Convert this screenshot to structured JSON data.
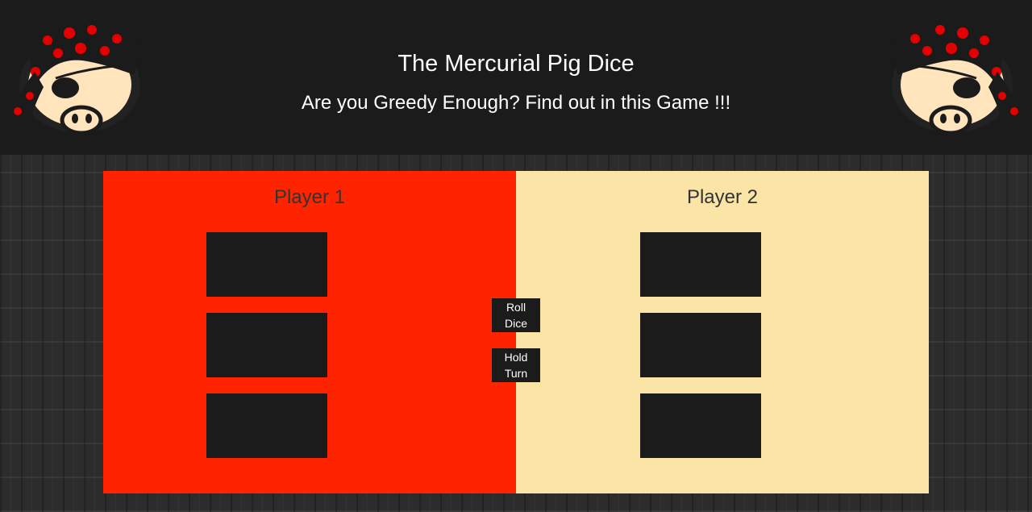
{
  "header": {
    "title": "The Mercurial Pig Dice",
    "subtitle": "Are you Greedy Enough? Find out in this Game !!!"
  },
  "icons": {
    "left_logo": "pirate-pig-logo-icon",
    "right_logo": "pirate-pig-logo-icon"
  },
  "colors": {
    "player1_background": "#ff2400",
    "player2_background": "#fae5a7",
    "box_background": "#1b1b1b",
    "header_background": "#1b1b1b"
  },
  "players": [
    {
      "name": "Player 1"
    },
    {
      "name": "Player 2"
    }
  ],
  "controls": {
    "roll_label": "Roll\nDice",
    "hold_label": "Hold\nTurn"
  }
}
